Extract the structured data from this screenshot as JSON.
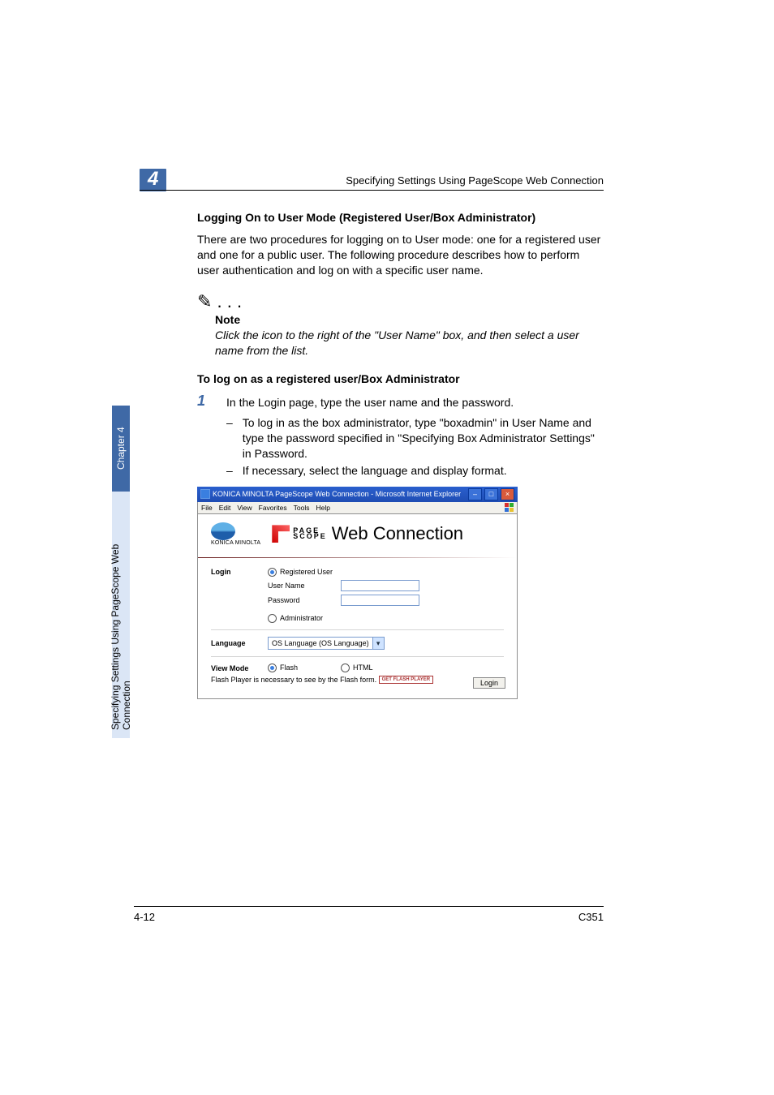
{
  "header": {
    "chapter_num": "4",
    "header_text": "Specifying Settings Using PageScope Web Connection"
  },
  "sidebar": {
    "dark_label": "Chapter 4",
    "light_label": "Specifying Settings Using PageScope Web Connection"
  },
  "body": {
    "section_title": "Logging On to User Mode (Registered User/Box Administrator)",
    "intro": "There are two procedures for logging on to User mode: one for a registered user and one for a public user. The following procedure describes how to perform user authentication and log on with a specific user name.",
    "note_label": "Note",
    "note_text": "Click the icon to the right of the \"User Name\" box, and then select a user name from the list.",
    "sub_title": "To log on as a registered user/Box Administrator",
    "step_num": "1",
    "step_text": "In the Login page, type the user name and the password.",
    "sub_items": [
      "To log in as the box administrator, type \"boxadmin\" in User Name and type the password specified in \"Specifying Box Administrator Settings\" in Password.",
      "If necessary, select the language and display format."
    ]
  },
  "screenshot": {
    "titlebar": "KONICA MINOLTA PageScope Web Connection - Microsoft Internet Explorer",
    "menu": [
      "File",
      "Edit",
      "View",
      "Favorites",
      "Tools",
      "Help"
    ],
    "brand_small": "KONICA MINOLTA",
    "ps_line1": "PAGE",
    "ps_line2": "SCOPE",
    "wc_label": "Web Connection",
    "login_label": "Login",
    "reg_user": "Registered User",
    "user_name": "User Name",
    "password": "Password",
    "admin": "Administrator",
    "language_label": "Language",
    "language_value": "OS Language (OS Language)",
    "viewmode_label": "View Mode",
    "flash": "Flash",
    "html": "HTML",
    "flash_note": "Flash Player is necessary to see by the Flash form.",
    "get_flash": "GET FLASH PLAYER",
    "login_btn": "Login"
  },
  "footer": {
    "left": "4-12",
    "right": "C351"
  }
}
